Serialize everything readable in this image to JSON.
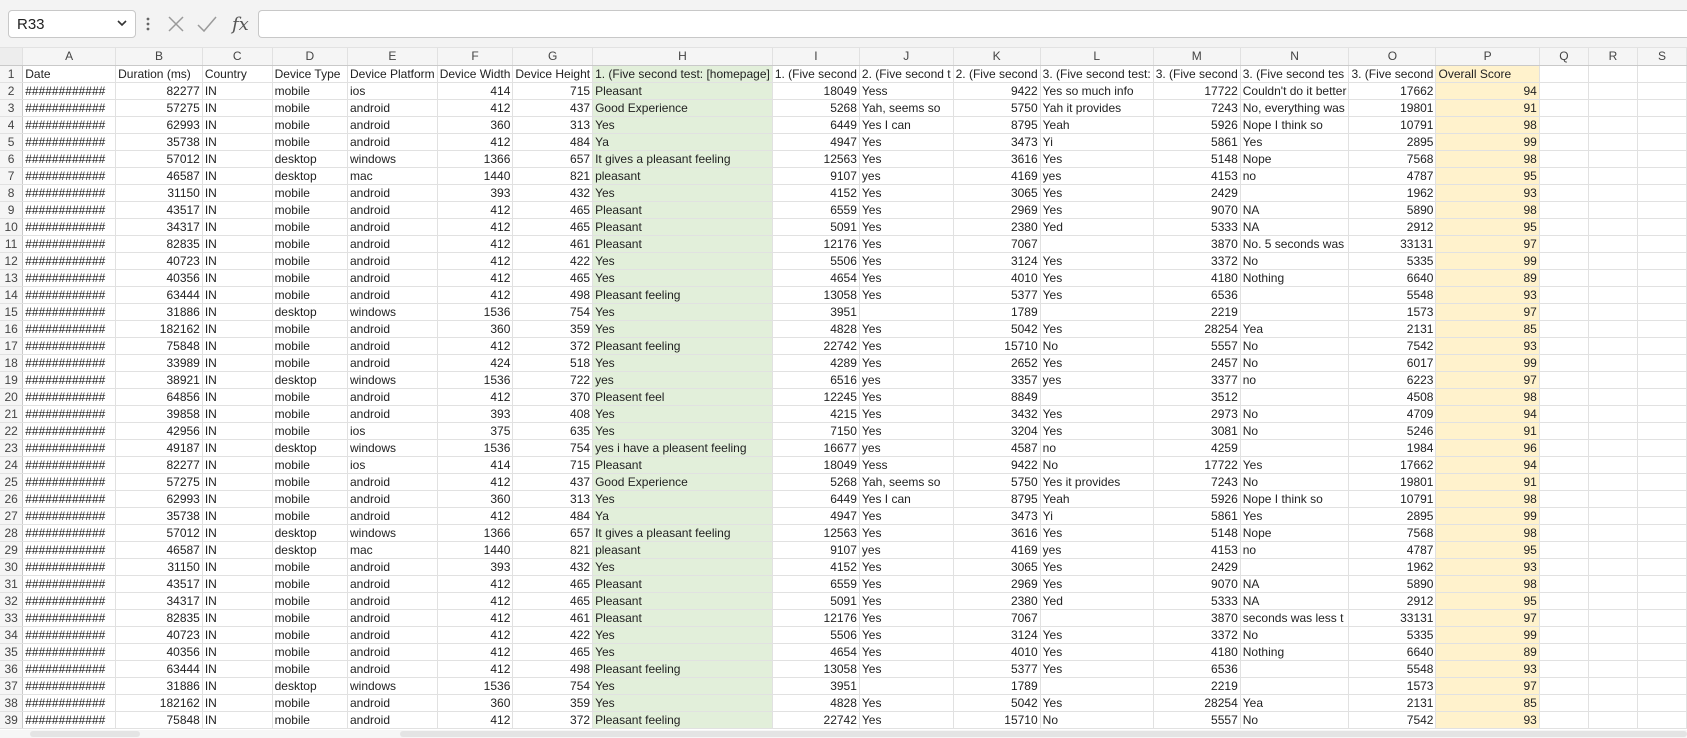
{
  "formula_bar": {
    "name_box": "R33",
    "fx_label": "fx",
    "formula_value": ""
  },
  "sheet": {
    "columns": [
      "A",
      "B",
      "C",
      "D",
      "E",
      "F",
      "G",
      "H",
      "I",
      "J",
      "K",
      "L",
      "M",
      "N",
      "O",
      "P",
      "Q",
      "R",
      "S"
    ],
    "headers": [
      "Date",
      "Duration (ms)",
      "Country",
      "Device Type",
      "Device Platform",
      "Device Width",
      "Device Height",
      "1. (Five second test: [homepage]",
      "1. (Five second",
      "2. (Five second t",
      "2. (Five second",
      "3. (Five second test:",
      "3. (Five second",
      "3. (Five second tes",
      "3. (Five second",
      "Overall Score",
      "",
      "",
      ""
    ],
    "rows": [
      [
        "############",
        "82277",
        "IN",
        "mobile",
        "ios",
        "414",
        "715",
        "Pleasant",
        "18049",
        "Yess",
        "9422",
        "Yes so much info",
        "17722",
        "Couldn't do it better",
        "17662",
        "94"
      ],
      [
        "############",
        "57275",
        "IN",
        "mobile",
        "android",
        "412",
        "437",
        "Good Experience",
        "5268",
        "Yah, seems so",
        "5750",
        "Yah it provides",
        "7243",
        "No, everything was",
        "19801",
        "91"
      ],
      [
        "############",
        "62993",
        "IN",
        "mobile",
        "android",
        "360",
        "313",
        "Yes",
        "6449",
        "Yes I can",
        "8795",
        "Yeah",
        "5926",
        "Nope I think so",
        "10791",
        "98"
      ],
      [
        "############",
        "35738",
        "IN",
        "mobile",
        "android",
        "412",
        "484",
        "Ya",
        "4947",
        "Yes",
        "3473",
        "Yi",
        "5861",
        "Yes",
        "2895",
        "99"
      ],
      [
        "############",
        "57012",
        "IN",
        "desktop",
        "windows",
        "1366",
        "657",
        "It gives a pleasant feeling",
        "12563",
        "Yes",
        "3616",
        "Yes",
        "5148",
        "Nope",
        "7568",
        "98"
      ],
      [
        "############",
        "46587",
        "IN",
        "desktop",
        "mac",
        "1440",
        "821",
        "pleasant",
        "9107",
        "yes",
        "4169",
        "yes",
        "4153",
        "no",
        "4787",
        "95"
      ],
      [
        "############",
        "31150",
        "IN",
        "mobile",
        "android",
        "393",
        "432",
        "Yes",
        "4152",
        "Yes",
        "3065",
        "Yes",
        "2429",
        "",
        "1962",
        "93"
      ],
      [
        "############",
        "43517",
        "IN",
        "mobile",
        "android",
        "412",
        "465",
        "Pleasant",
        "6559",
        "Yes",
        "2969",
        "Yes",
        "9070",
        "NA",
        "5890",
        "98"
      ],
      [
        "############",
        "34317",
        "IN",
        "mobile",
        "android",
        "412",
        "465",
        "Pleasant",
        "5091",
        "Yes",
        "2380",
        "Yed",
        "5333",
        "NA",
        "2912",
        "95"
      ],
      [
        "############",
        "82835",
        "IN",
        "mobile",
        "android",
        "412",
        "461",
        "Pleasant",
        "12176",
        "Yes",
        "7067",
        "",
        "3870",
        "No. 5 seconds was",
        "33131",
        "97"
      ],
      [
        "############",
        "40723",
        "IN",
        "mobile",
        "android",
        "412",
        "422",
        "Yes",
        "5506",
        "Yes",
        "3124",
        "Yes",
        "3372",
        "No",
        "5335",
        "99"
      ],
      [
        "############",
        "40356",
        "IN",
        "mobile",
        "android",
        "412",
        "465",
        "Yes",
        "4654",
        "Yes",
        "4010",
        "Yes",
        "4180",
        "Nothing",
        "6640",
        "89"
      ],
      [
        "############",
        "63444",
        "IN",
        "mobile",
        "android",
        "412",
        "498",
        "Pleasant feeling",
        "13058",
        "Yes",
        "5377",
        "Yes",
        "6536",
        "",
        "5548",
        "93"
      ],
      [
        "############",
        "31886",
        "IN",
        "desktop",
        "windows",
        "1536",
        "754",
        "Yes",
        "3951",
        "",
        "1789",
        "",
        "2219",
        "",
        "1573",
        "97"
      ],
      [
        "############",
        "182162",
        "IN",
        "mobile",
        "android",
        "360",
        "359",
        "Yes",
        "4828",
        "Yes",
        "5042",
        "Yes",
        "28254",
        "Yea",
        "2131",
        "85"
      ],
      [
        "############",
        "75848",
        "IN",
        "mobile",
        "android",
        "412",
        "372",
        "Pleasant feeling",
        "22742",
        "Yes",
        "15710",
        "No",
        "5557",
        "No",
        "7542",
        "93"
      ],
      [
        "############",
        "33989",
        "IN",
        "mobile",
        "android",
        "424",
        "518",
        "Yes",
        "4289",
        "Yes",
        "2652",
        "Yes",
        "2457",
        "No",
        "6017",
        "99"
      ],
      [
        "############",
        "38921",
        "IN",
        "desktop",
        "windows",
        "1536",
        "722",
        "yes",
        "6516",
        "yes",
        "3357",
        "yes",
        "3377",
        "no",
        "6223",
        "97"
      ],
      [
        "############",
        "64856",
        "IN",
        "mobile",
        "android",
        "412",
        "370",
        "Pleasent feel",
        "12245",
        "Yes",
        "8849",
        "",
        "3512",
        "",
        "4508",
        "98"
      ],
      [
        "############",
        "39858",
        "IN",
        "mobile",
        "android",
        "393",
        "408",
        "Yes",
        "4215",
        "Yes",
        "3432",
        "Yes",
        "2973",
        "No",
        "4709",
        "94"
      ],
      [
        "############",
        "42956",
        "IN",
        "mobile",
        "ios",
        "375",
        "635",
        "Yes",
        "7150",
        "Yes",
        "3204",
        "Yes",
        "3081",
        "No",
        "5246",
        "91"
      ],
      [
        "############",
        "49187",
        "IN",
        "desktop",
        "windows",
        "1536",
        "754",
        "yes i have a pleasent feeling",
        "16677",
        "yes",
        "4587",
        "no",
        "4259",
        "",
        "1984",
        "96"
      ],
      [
        "############",
        "82277",
        "IN",
        "mobile",
        "ios",
        "414",
        "715",
        "Pleasant",
        "18049",
        "Yess",
        "9422",
        "No",
        "17722",
        "Yes",
        "17662",
        "94"
      ],
      [
        "############",
        "57275",
        "IN",
        "mobile",
        "android",
        "412",
        "437",
        "Good Experience",
        "5268",
        "Yah, seems so",
        "5750",
        "Yes it provides",
        "7243",
        "No",
        "19801",
        "91"
      ],
      [
        "############",
        "62993",
        "IN",
        "mobile",
        "android",
        "360",
        "313",
        "Yes",
        "6449",
        "Yes I can",
        "8795",
        "Yeah",
        "5926",
        "Nope I think so",
        "10791",
        "98"
      ],
      [
        "############",
        "35738",
        "IN",
        "mobile",
        "android",
        "412",
        "484",
        "Ya",
        "4947",
        "Yes",
        "3473",
        "Yi",
        "5861",
        "Yes",
        "2895",
        "99"
      ],
      [
        "############",
        "57012",
        "IN",
        "desktop",
        "windows",
        "1366",
        "657",
        "It gives a pleasant feeling",
        "12563",
        "Yes",
        "3616",
        "Yes",
        "5148",
        "Nope",
        "7568",
        "98"
      ],
      [
        "############",
        "46587",
        "IN",
        "desktop",
        "mac",
        "1440",
        "821",
        "pleasant",
        "9107",
        "yes",
        "4169",
        "yes",
        "4153",
        "no",
        "4787",
        "95"
      ],
      [
        "############",
        "31150",
        "IN",
        "mobile",
        "android",
        "393",
        "432",
        "Yes",
        "4152",
        "Yes",
        "3065",
        "Yes",
        "2429",
        "",
        "1962",
        "93"
      ],
      [
        "############",
        "43517",
        "IN",
        "mobile",
        "android",
        "412",
        "465",
        "Pleasant",
        "6559",
        "Yes",
        "2969",
        "Yes",
        "9070",
        "NA",
        "5890",
        "98"
      ],
      [
        "############",
        "34317",
        "IN",
        "mobile",
        "android",
        "412",
        "465",
        "Pleasant",
        "5091",
        "Yes",
        "2380",
        "Yed",
        "5333",
        "NA",
        "2912",
        "95"
      ],
      [
        "############",
        "82835",
        "IN",
        "mobile",
        "android",
        "412",
        "461",
        "Pleasant",
        "12176",
        "Yes",
        "7067",
        "",
        "3870",
        "seconds was less t",
        "33131",
        "97"
      ],
      [
        "############",
        "40723",
        "IN",
        "mobile",
        "android",
        "412",
        "422",
        "Yes",
        "5506",
        "Yes",
        "3124",
        "Yes",
        "3372",
        "No",
        "5335",
        "99"
      ],
      [
        "############",
        "40356",
        "IN",
        "mobile",
        "android",
        "412",
        "465",
        "Yes",
        "4654",
        "Yes",
        "4010",
        "Yes",
        "4180",
        "Nothing",
        "6640",
        "89"
      ],
      [
        "############",
        "63444",
        "IN",
        "mobile",
        "android",
        "412",
        "498",
        "Pleasant feeling",
        "13058",
        "Yes",
        "5377",
        "Yes",
        "6536",
        "",
        "5548",
        "93"
      ],
      [
        "############",
        "31886",
        "IN",
        "desktop",
        "windows",
        "1536",
        "754",
        "Yes",
        "3951",
        "",
        "1789",
        "",
        "2219",
        "",
        "1573",
        "97"
      ],
      [
        "############",
        "182162",
        "IN",
        "mobile",
        "android",
        "360",
        "359",
        "Yes",
        "4828",
        "Yes",
        "5042",
        "Yes",
        "28254",
        "Yea",
        "2131",
        "85"
      ],
      [
        "############",
        "75848",
        "IN",
        "mobile",
        "android",
        "412",
        "372",
        "Pleasant feeling",
        "22742",
        "Yes",
        "15710",
        "No",
        "5557",
        "No",
        "7542",
        "93"
      ]
    ]
  },
  "colors": {
    "green_column": "#e2efda",
    "yellow_column": "#fff2cc"
  },
  "icons": {
    "cancel": "close-icon",
    "confirm": "checkmark-icon",
    "name_box_dropdown": "chevron-down-icon",
    "more": "more-vertical-icon"
  }
}
